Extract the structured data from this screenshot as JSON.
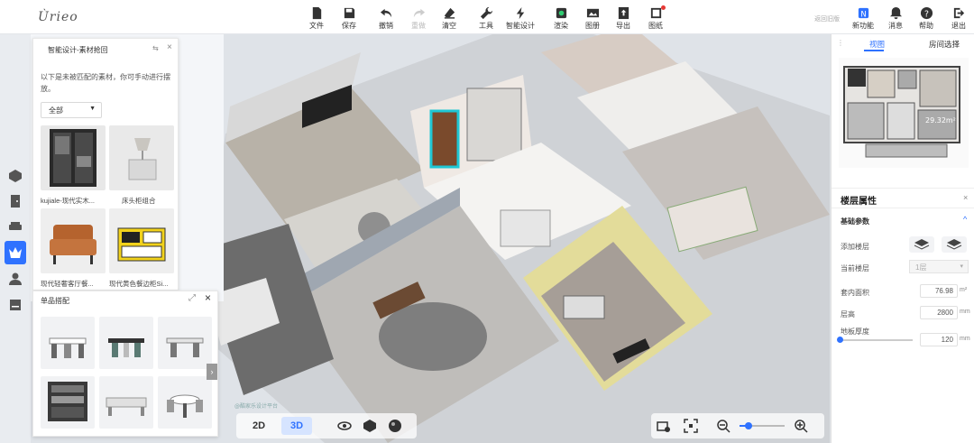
{
  "app": {
    "logo": "Ùrieo",
    "back_link": "返回旧版"
  },
  "toolbar": {
    "file": "文件",
    "save": "保存",
    "undo": "撤销",
    "redo": "重做",
    "clear": "清空",
    "tools": "工具",
    "smart_design": "智能设计",
    "render": "渲染",
    "album": "图册",
    "export": "导出",
    "drawing": "图纸",
    "new_feature": "新功能",
    "messages": "消息",
    "help": "帮助",
    "exit": "退出"
  },
  "material_panel": {
    "title": "智能设计-素材抢回",
    "description": "以下是未被匹配的素材，你可手动进行摆放。",
    "filter": "全部",
    "items": [
      {
        "label": "kujiale-现代实木..."
      },
      {
        "label": "床头柜组合"
      },
      {
        "label": "现代轻奢客厅餐..."
      },
      {
        "label": "现代黄色餐边柜Si..."
      }
    ]
  },
  "set_panel": {
    "title": "单品搭配"
  },
  "view": {
    "mode_2d": "2D",
    "mode_3d": "3D",
    "watermark": "@酷家乐设计平台"
  },
  "right_panel": {
    "tab_view": "视图",
    "tab_room": "房间选择",
    "floor_props": "楼层属性",
    "basic_params": "基础参数",
    "add_floor": "添加楼层",
    "current_floor": "当前楼层",
    "current_floor_value": "1层",
    "inner_area": "套内面积",
    "inner_area_value": "76.98",
    "area_unit": "m²",
    "floor_height": "层高",
    "floor_height_value": "2800",
    "unit_mm": "mm",
    "slab_thickness": "地板厚度",
    "slab_thickness_value": "120",
    "minimap_area": "29.32m²"
  },
  "colors": {
    "accent": "#2f72ff",
    "selection": "#1fc7d4"
  },
  "icons": {
    "rail": [
      "cube-icon",
      "door-icon",
      "sofa-icon",
      "crown-icon",
      "person-icon",
      "cabinet-icon"
    ]
  }
}
